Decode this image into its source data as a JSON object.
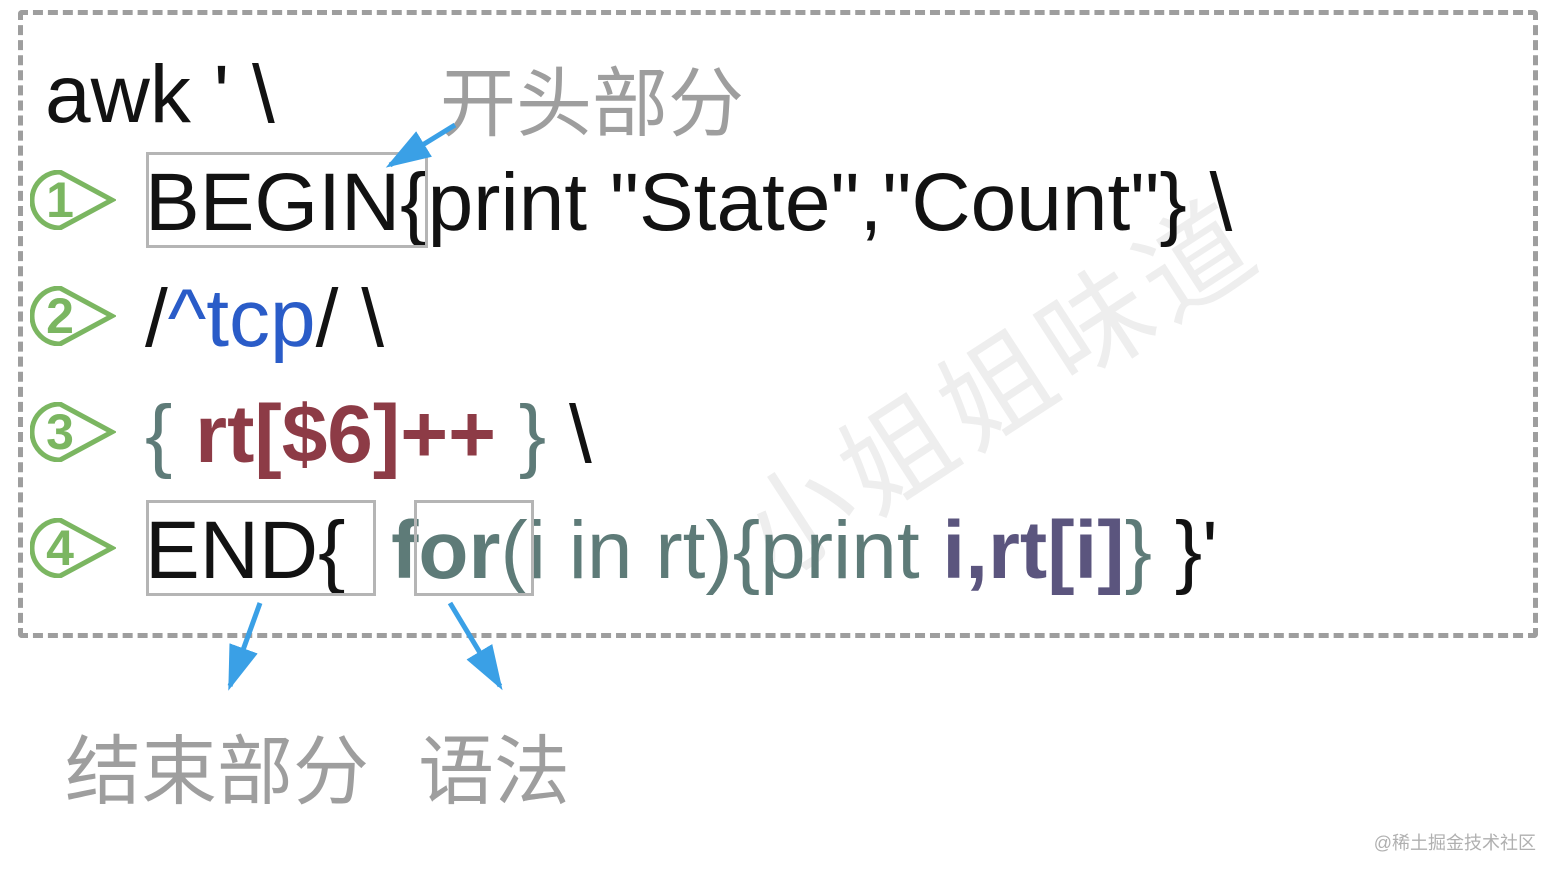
{
  "labels": {
    "opening": "开头部分",
    "ending": "结束部分",
    "syntax": "语法"
  },
  "bullets": {
    "n1": "1",
    "n2": "2",
    "n3": "3",
    "n4": "4"
  },
  "code": {
    "line0": "awk ' \\",
    "line1_begin": "BEGIN{",
    "line1_print": "print",
    "line1_rest": " \"State\",\"Count\"}  \\",
    "line2_slash1": "/",
    "line2_regex": "^tcp",
    "line2_slash2": "/ \\",
    "line3_open": "{  ",
    "line3_body": "rt[$6]++",
    "line3_close": " } \\",
    "line4_end": "END{",
    "line4_for": "for",
    "line4_args": "(i in rt){",
    "line4_print": "print",
    "line4_irt": " i,rt[i]",
    "line4_brace1": "}",
    "line4_close": "  }'"
  },
  "watermark": {
    "big": "小姐姐味道",
    "small": "@稀土掘金技术社区"
  }
}
